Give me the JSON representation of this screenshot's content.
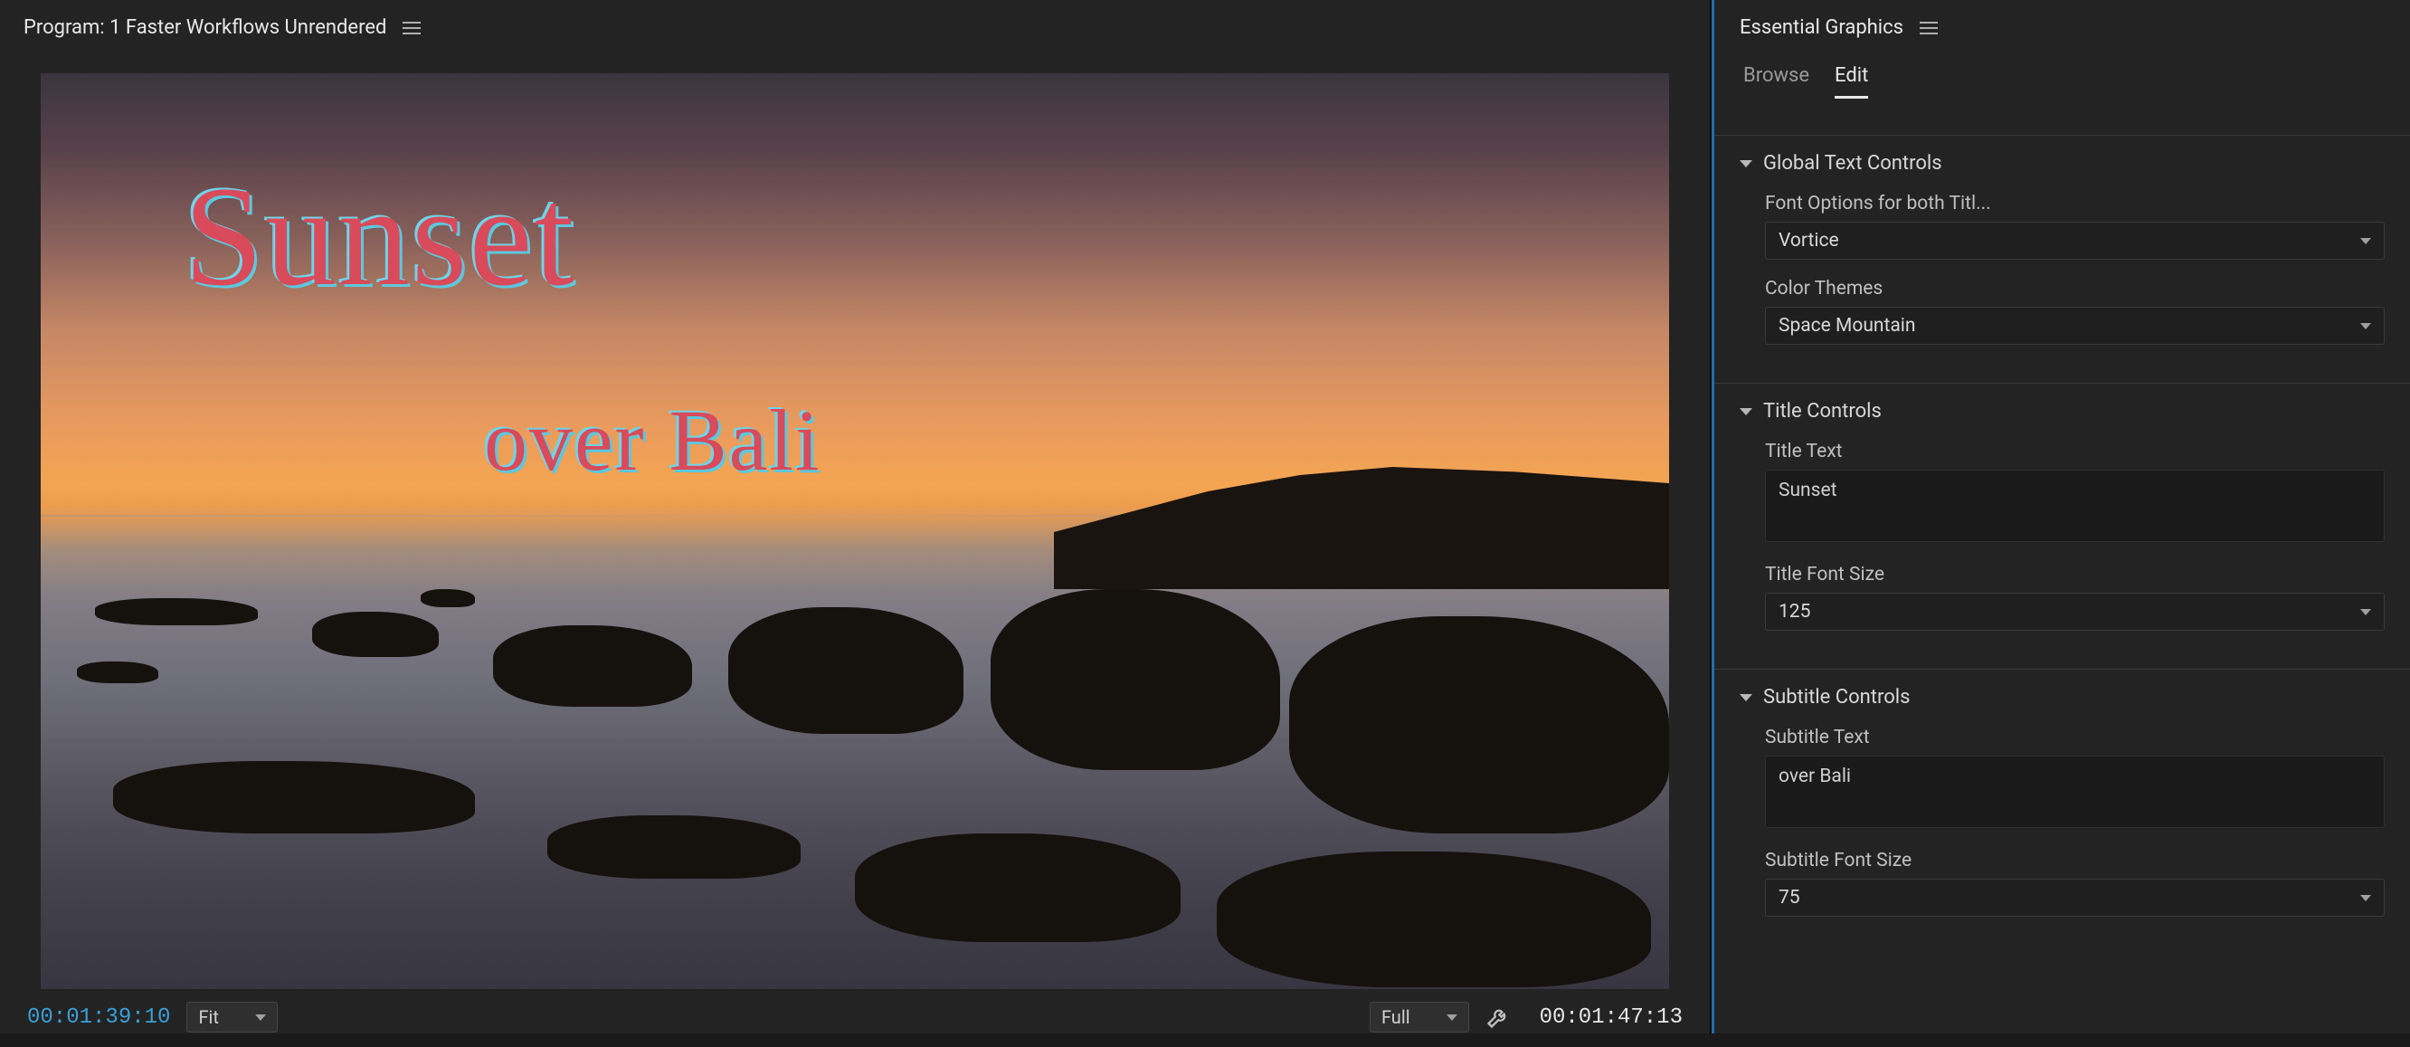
{
  "program": {
    "header": "Program: 1 Faster Workflows Unrendered",
    "current_tc": "00:01:39:10",
    "fit_label": "Fit",
    "full_label": "Full",
    "duration_tc": "00:01:47:13",
    "overlay_title": "Sunset",
    "overlay_subtitle": "over Bali"
  },
  "essential_graphics": {
    "panel_title": "Essential Graphics",
    "tabs": {
      "browse": "Browse",
      "edit": "Edit"
    },
    "sections": {
      "global": {
        "title": "Global Text Controls",
        "font_label": "Font Options for both Titl...",
        "font_value": "Vortice",
        "theme_label": "Color Themes",
        "theme_value": "Space Mountain"
      },
      "title": {
        "title": "Title Controls",
        "text_label": "Title Text",
        "text_value": "Sunset",
        "size_label": "Title Font Size",
        "size_value": "125"
      },
      "subtitle": {
        "title": "Subtitle Controls",
        "text_label": "Subtitle Text",
        "text_value": "over Bali",
        "size_label": "Subtitle Font Size",
        "size_value": "75"
      }
    }
  }
}
